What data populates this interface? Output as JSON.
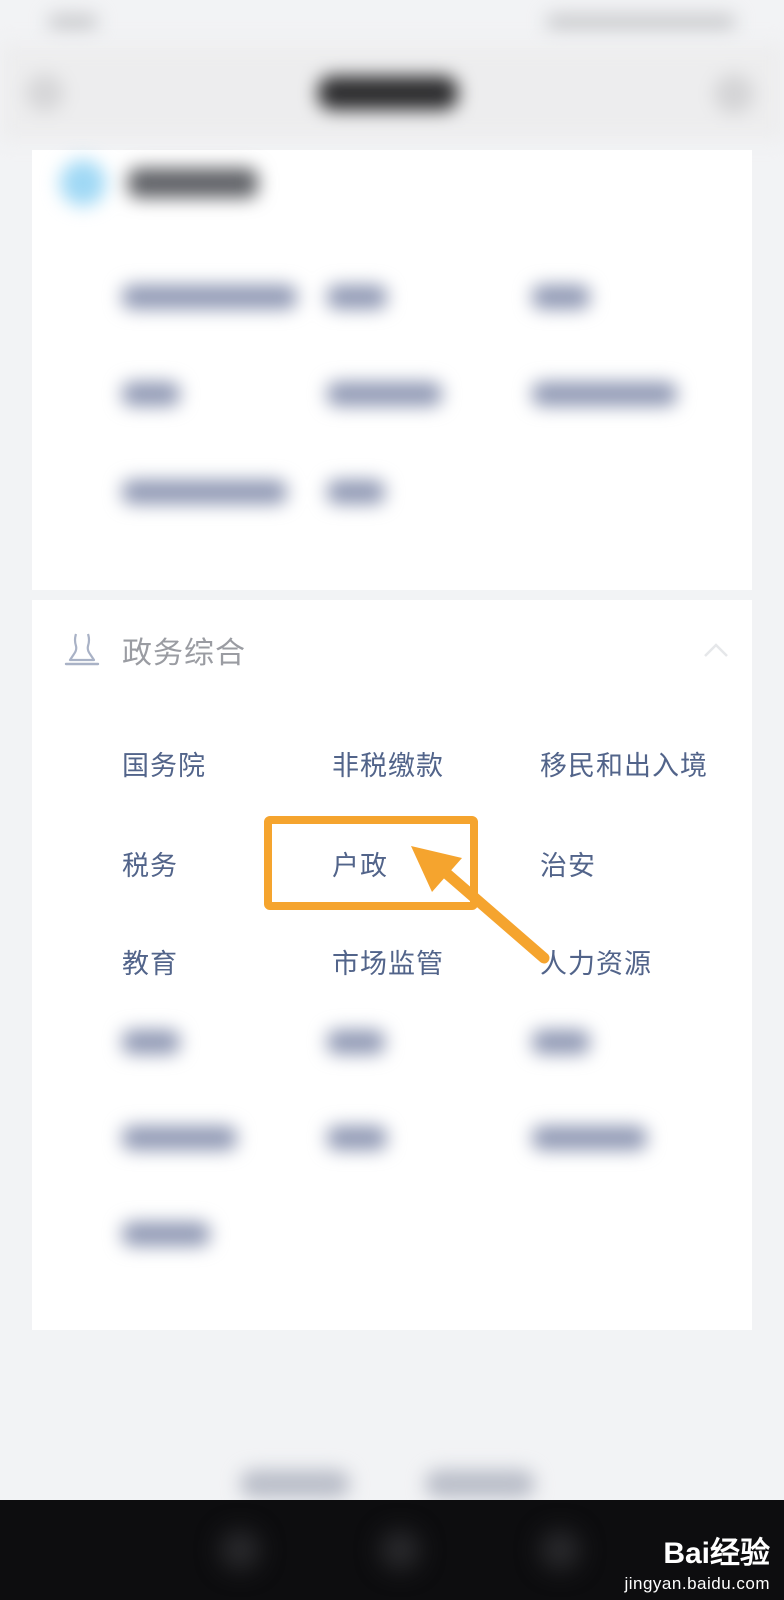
{
  "section": {
    "title": "政务综合",
    "items": [
      "国务院",
      "非税缴款",
      "移民和出入境",
      "税务",
      "户政",
      "治安",
      "教育",
      "市场监管",
      "人力资源"
    ]
  },
  "annotation": {
    "highlighted_item": "户政",
    "color": "#f5a42e"
  },
  "colors": {
    "item_text": "#52648a",
    "section_title": "#9a9ca2",
    "background": "#f2f3f5"
  },
  "watermark": {
    "logo": "Bai经验",
    "url": "jingyan.baidu.com"
  },
  "icons": {
    "section_icon": "government-building-icon",
    "collapse": "chevron-up-icon"
  }
}
